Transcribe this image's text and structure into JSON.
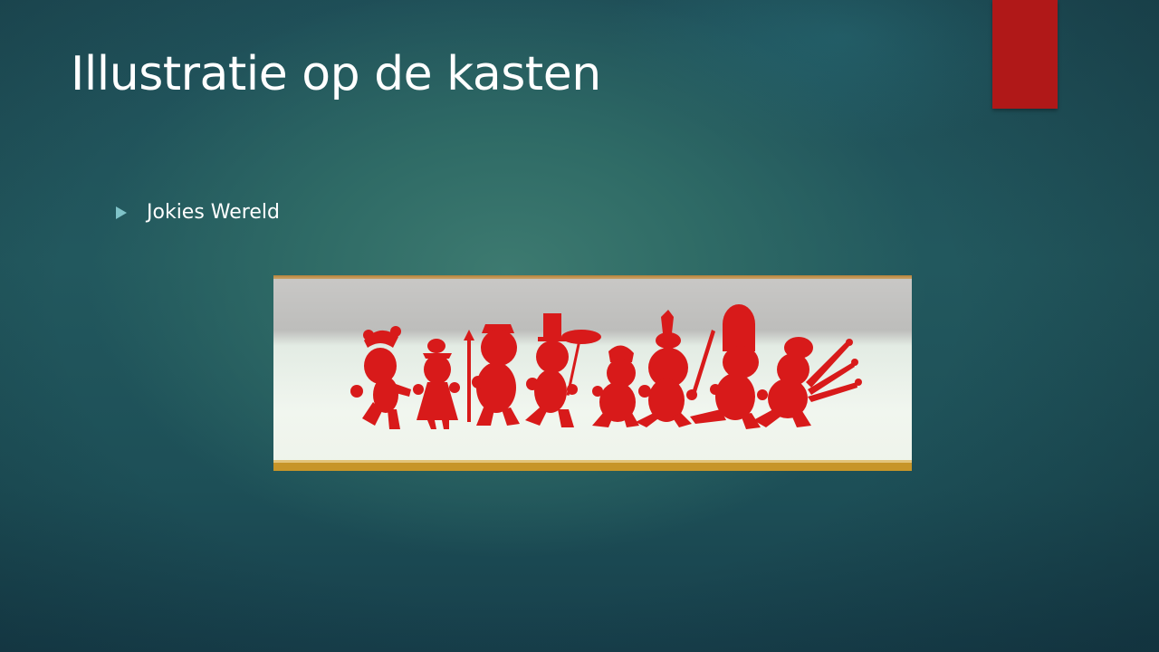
{
  "slide": {
    "title": "Illustratie op de kasten",
    "bullets": [
      {
        "text": "Jokies Wereld"
      }
    ],
    "accent_color": "#b01818",
    "bullet_color": "#7fc3c8",
    "image": {
      "description_icon": "red-silhouette-figures-photo",
      "figure_color": "#d81a1a"
    }
  }
}
